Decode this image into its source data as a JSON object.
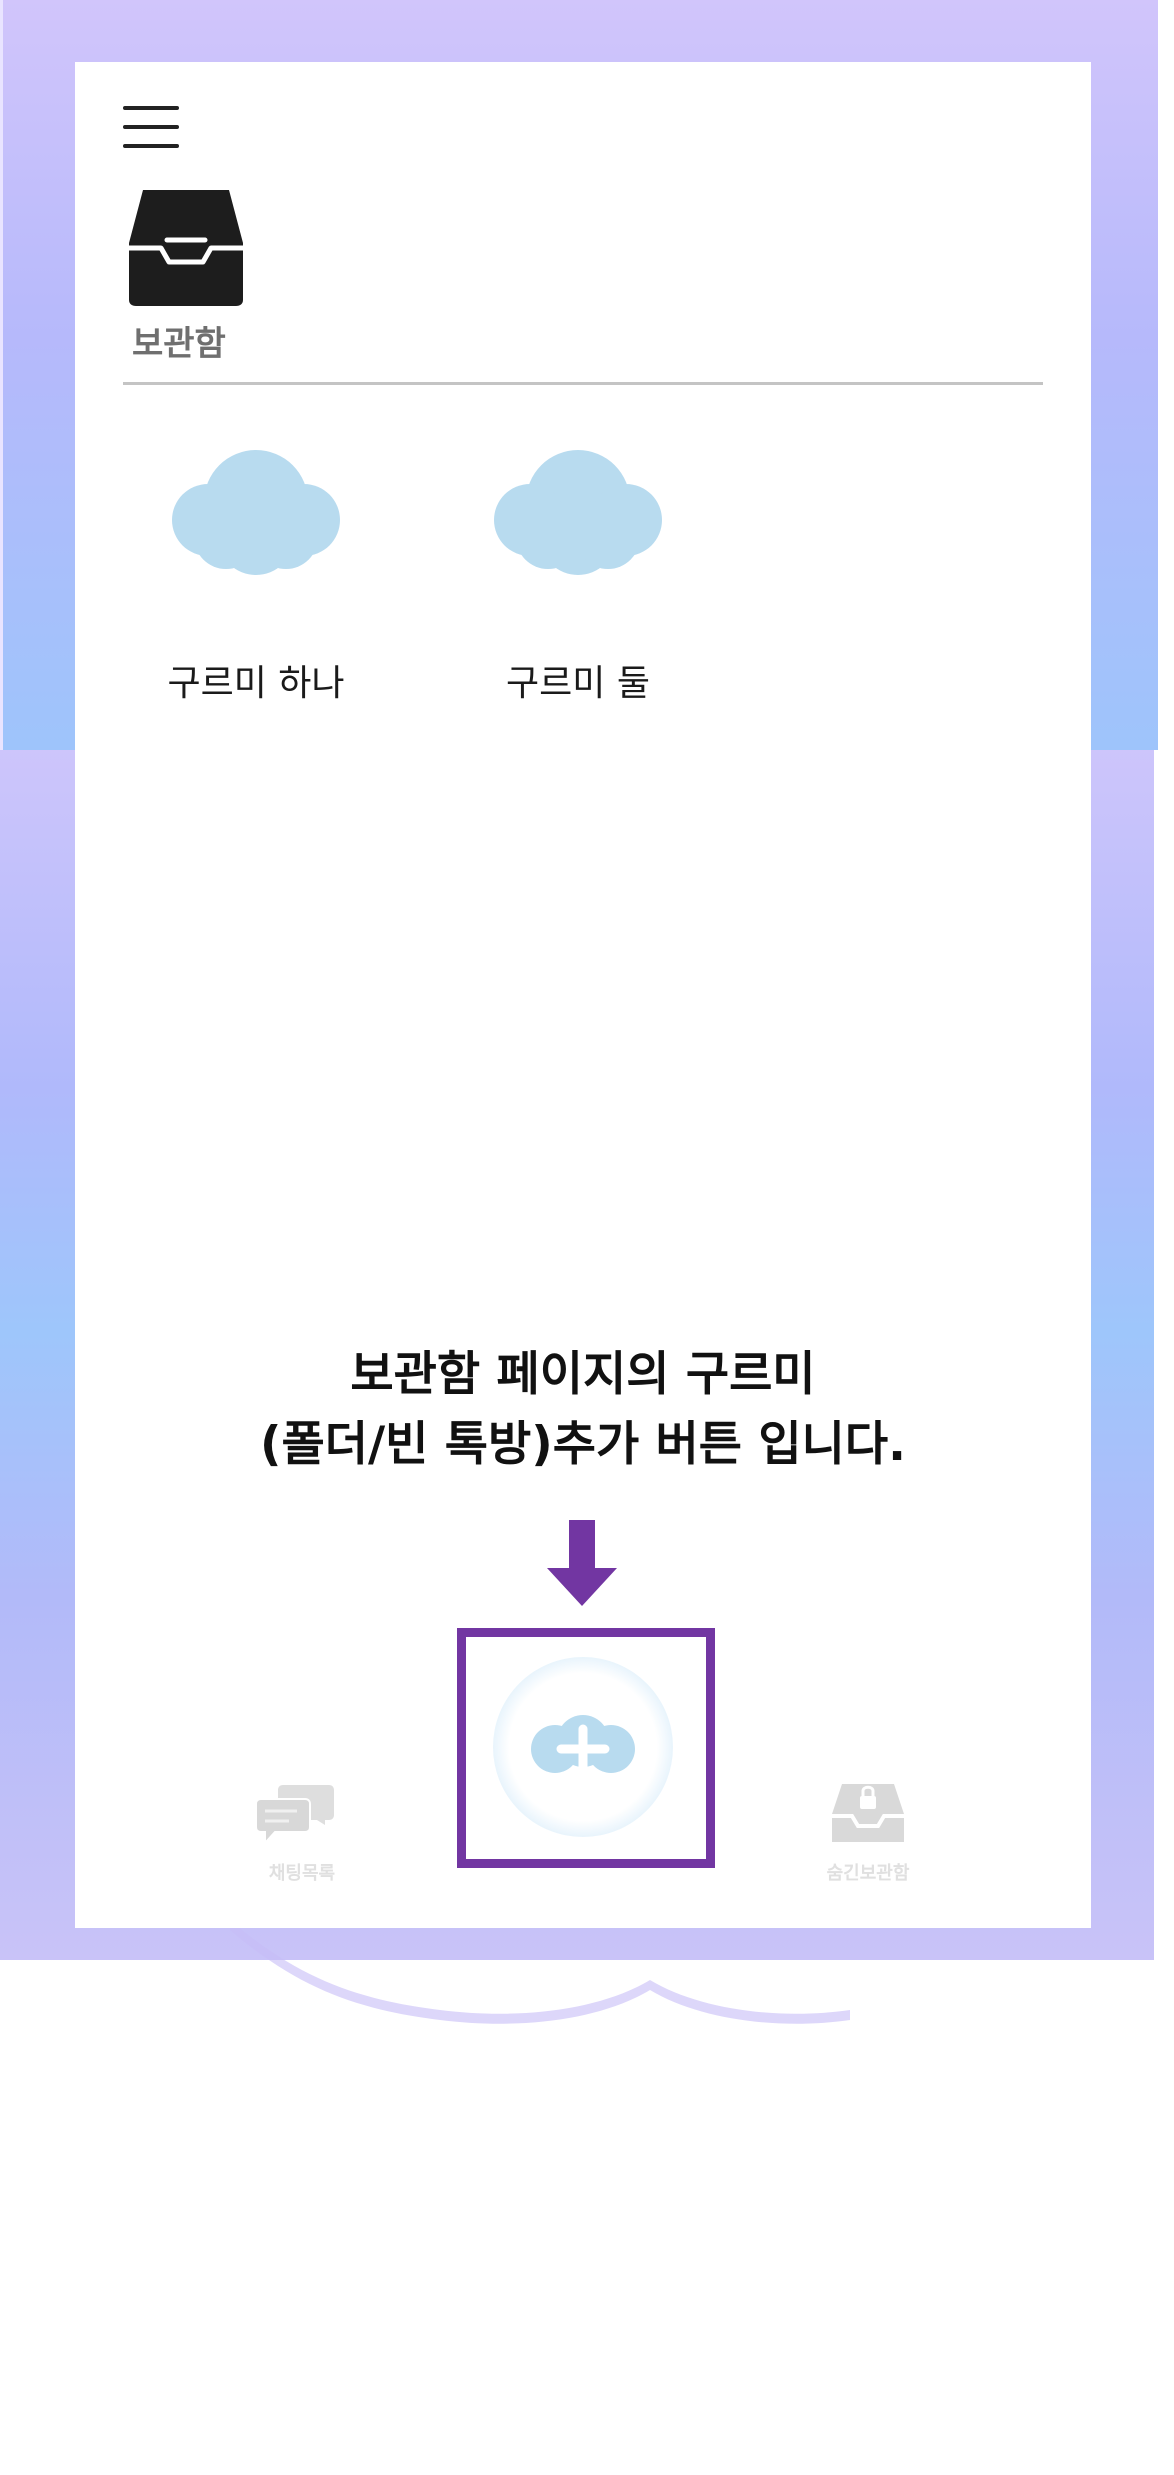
{
  "header": {
    "menu_icon": "hamburger-menu-icon",
    "page_icon": "inbox-tray-icon",
    "page_title": "보관함"
  },
  "folders": [
    {
      "name": "구르미 하나",
      "icon": "cloud-icon"
    },
    {
      "name": "구르미 둘",
      "icon": "cloud-icon"
    }
  ],
  "guide": {
    "line1": "보관함 페이지의 구르미",
    "line2": "(폴더/빈 톡방)추가 버튼 입니다.",
    "arrow_icon": "down-arrow-icon",
    "highlight_color": "#7236a2"
  },
  "bottom_nav": {
    "add_button_icon": "plus-cloud-icon",
    "chat_label": "채팅목록",
    "chat_icon": "chat-bubbles-icon",
    "secret_label": "숨긴보관함",
    "secret_icon": "locked-inbox-icon"
  },
  "colors": {
    "cloud": "#b8dbef",
    "accent": "#7236a2",
    "background_gradient_top": "#d1c5fb",
    "background_gradient_mid": "#9ec4fb"
  }
}
